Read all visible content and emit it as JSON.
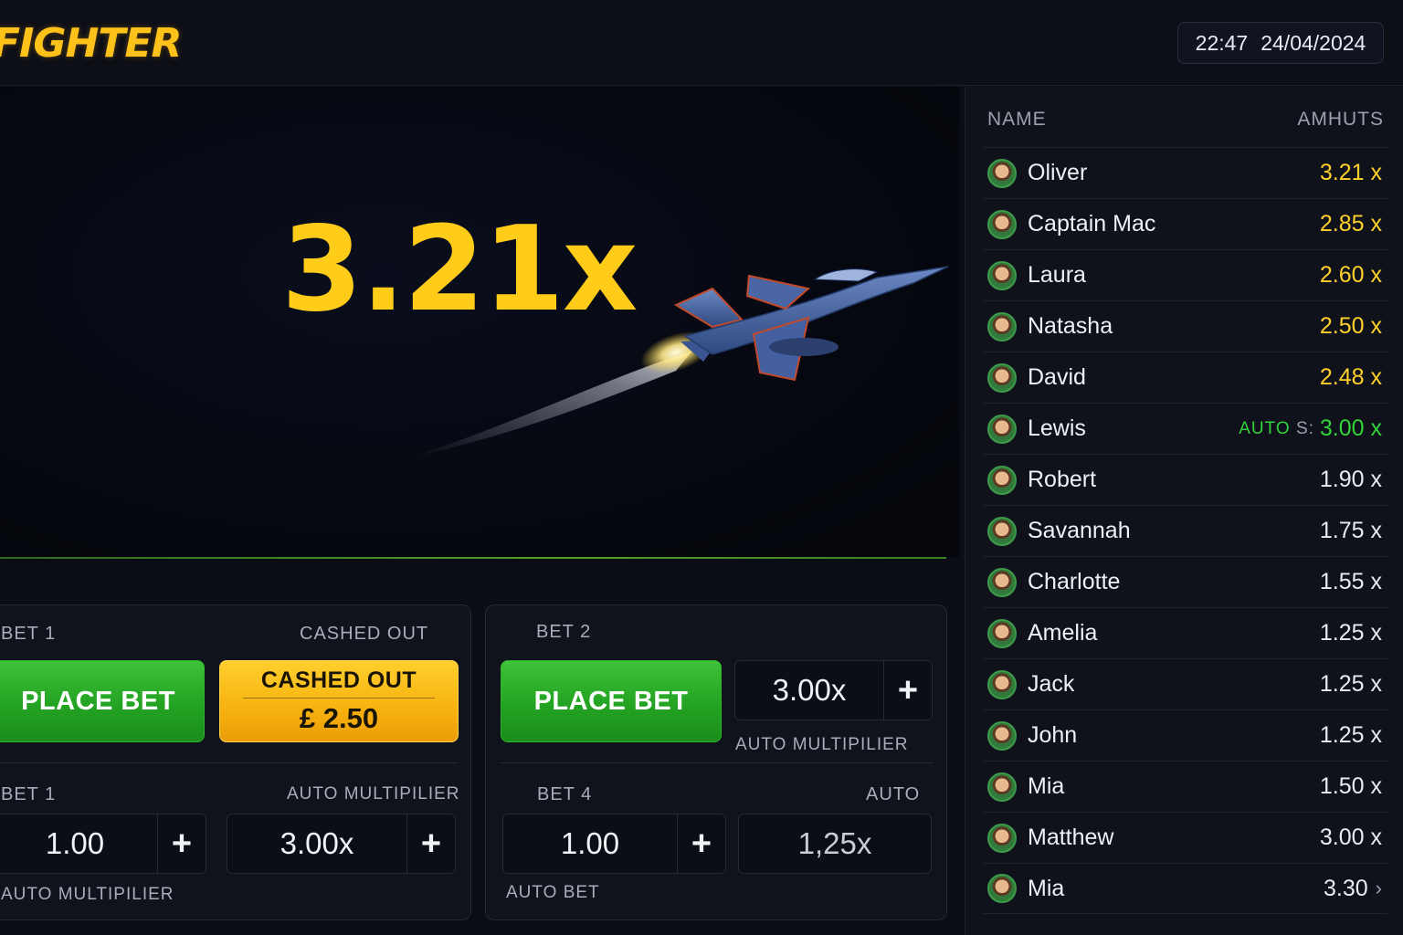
{
  "header": {
    "logo": "FIGHTER",
    "time": "22:47",
    "date": "24/04/2024"
  },
  "game": {
    "multiplier": "3.21x"
  },
  "bet_panel_1": {
    "top_label": "BET 1",
    "cashed_label": "CASHED OUT",
    "place_bet": "PLACE BET",
    "cashout_title": "CASHED OUT",
    "cashout_amount": "£ 2.50",
    "bottom_label": "BET 1",
    "auto_mult_label": "AUTO MULTIPILIER",
    "amount_value": "1.00",
    "multiplier_value": "3.00x",
    "footer_label": "AUTO MULTIPILIER"
  },
  "bet_panel_2": {
    "top_label": "BET 2",
    "place_bet": "PLACE BET",
    "multiplier_value": "3.00x",
    "auto_mult_label": "AUTO MULTIPILIER",
    "bottom_label": "BET 4",
    "auto_label": "AUTO",
    "amount_value": "1.00",
    "auto_value": "1,25x",
    "footer_label": "AUTO BET"
  },
  "plus_icon": "+",
  "leaderboard": {
    "col_name": "NAME",
    "col_amount": "AMHUTS",
    "rows": [
      {
        "name": "Oliver",
        "value": "3.21 x",
        "style": "gold"
      },
      {
        "name": "Captain Mac",
        "value": "2.85 x",
        "style": "gold"
      },
      {
        "name": "Laura",
        "value": "2.60 x",
        "style": "gold"
      },
      {
        "name": "Natasha",
        "value": "2.50 x",
        "style": "gold"
      },
      {
        "name": "David",
        "value": "2.48 x",
        "style": "gold"
      },
      {
        "name": "Lewis",
        "value": "3.00 x",
        "style": "green",
        "auto": "AUTO",
        "auto_suffix": "S:"
      },
      {
        "name": "Robert",
        "value": "1.90 x",
        "style": "white"
      },
      {
        "name": "Savannah",
        "value": "1.75 x",
        "style": "white"
      },
      {
        "name": "Charlotte",
        "value": "1.55 x",
        "style": "white"
      },
      {
        "name": "Amelia",
        "value": "1.25 x",
        "style": "white"
      },
      {
        "name": "Jack",
        "value": "1.25 x",
        "style": "white"
      },
      {
        "name": "John",
        "value": "1.25 x",
        "style": "white"
      },
      {
        "name": "Mia",
        "value": "1.50 x",
        "style": "white"
      },
      {
        "name": "Matthew",
        "value": "3.00 x",
        "style": "white"
      },
      {
        "name": "Mia",
        "value": "3.30",
        "style": "white",
        "chevron": "›"
      }
    ]
  },
  "colors": {
    "gold": "#ffcc1a",
    "green": "#23a322",
    "auto_green": "#33d23a"
  }
}
